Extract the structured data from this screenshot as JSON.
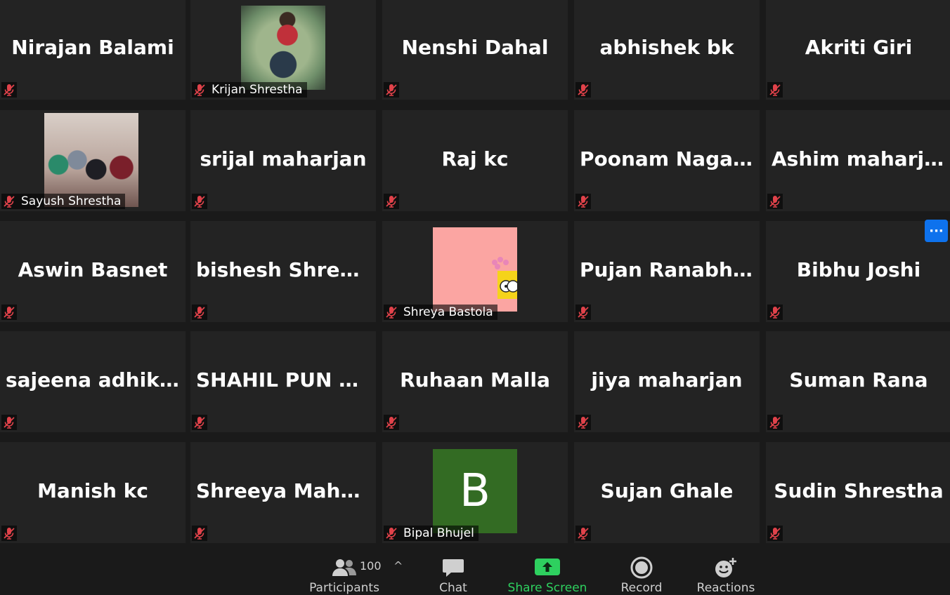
{
  "participants": [
    {
      "name": "Nirajan Balami",
      "type": "name"
    },
    {
      "name": "Krijan Shrestha",
      "type": "video",
      "label": "Krijan Shrestha",
      "thumb": "photo1"
    },
    {
      "name": "Nenshi Dahal",
      "type": "name"
    },
    {
      "name": "abhishek bk",
      "type": "name"
    },
    {
      "name": "Akriti Giri",
      "type": "name"
    },
    {
      "name": "Sayush Shrestha",
      "type": "video",
      "label": "Sayush Shrestha",
      "thumb": "photo2"
    },
    {
      "name": "srijal maharjan",
      "type": "name"
    },
    {
      "name": "Raj kc",
      "type": "name"
    },
    {
      "name": "Poonam  Nagar...",
      "type": "name"
    },
    {
      "name": "Ashim maharjan",
      "type": "name"
    },
    {
      "name": "Aswin Basnet",
      "type": "name"
    },
    {
      "name": "bishesh Shrestha",
      "type": "name"
    },
    {
      "name": "Shreya Bastola",
      "type": "video",
      "label": "Shreya Bastola",
      "thumb": "pink"
    },
    {
      "name": "Pujan Ranabhat",
      "type": "name"
    },
    {
      "name": "Bibhu Joshi",
      "type": "name"
    },
    {
      "name": "sajeena adhikari",
      "type": "name"
    },
    {
      "name": "SHAHIL  PUN  M...",
      "type": "name"
    },
    {
      "name": "Ruhaan Malla",
      "type": "name"
    },
    {
      "name": "jiya maharjan",
      "type": "name"
    },
    {
      "name": "Suman Rana",
      "type": "name"
    },
    {
      "name": "Manish kc",
      "type": "name"
    },
    {
      "name": "Shreeya  Maharj...",
      "type": "name"
    },
    {
      "name": "Bipal Bhujel",
      "type": "video",
      "label": "Bipal Bhujel",
      "thumb": "green",
      "initial": "B"
    },
    {
      "name": "Sujan Ghale",
      "type": "name"
    },
    {
      "name": "Sudin Shrestha",
      "type": "name"
    }
  ],
  "more_button": {
    "label": "···"
  },
  "toolbar": {
    "participants_label": "Participants",
    "participants_count": "100",
    "caret": "^",
    "chat_label": "Chat",
    "share_label": "Share Screen",
    "record_label": "Record",
    "reactions_label": "Reactions"
  },
  "colors": {
    "muted_mic": "#e0424a",
    "share_green": "#2ed05f",
    "more_blue": "#0e72ed"
  }
}
